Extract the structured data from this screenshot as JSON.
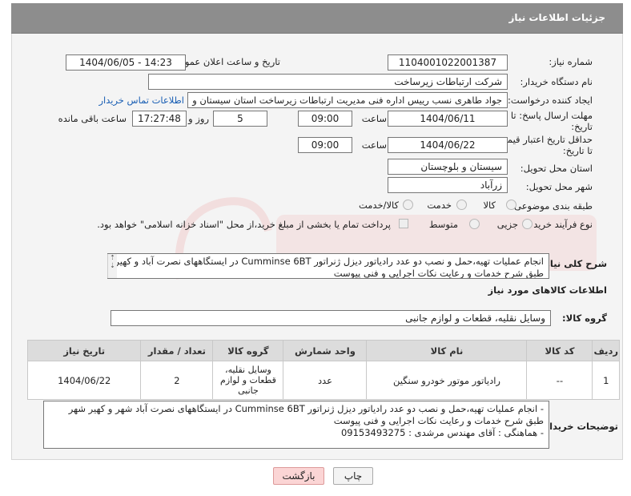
{
  "header": {
    "title": "جزئیات اطلاعات نیاز"
  },
  "fields": {
    "need_number_label": "شماره نیاز:",
    "need_number": "1104001022001387",
    "announce_label": "تاریخ و ساعت اعلان عمومی:",
    "announce_value": "1404/06/05 - 14:23",
    "buyer_org_label": "نام دستگاه خریدار:",
    "buyer_org": "شرکت ارتباطات زیرساخت",
    "creator_label": "ایجاد کننده درخواست:",
    "creator": "جواد طاهری نسب رییس اداره فنی مدیریت ارتباطات زیرساخت استان سیستان و",
    "contact_link": "اطلاعات تماس خریدار",
    "deadline_label": "مهلت ارسال پاسخ: تا",
    "deadline_label2": "تاریخ:",
    "deadline_date": "1404/06/11",
    "time_label": "ساعت",
    "deadline_time": "09:00",
    "days_value": "5",
    "days_label": "روز و",
    "remaining_time": "17:27:48",
    "remaining_label": "ساعت باقی مانده",
    "min_price_label": "حداقل تاریخ اعتبار قیمت:",
    "min_price_label2": "تا تاریخ:",
    "min_price_date": "1404/06/22",
    "min_price_time": "09:00",
    "province_label": "استان محل تحویل:",
    "province": "سیستان و بلوچستان",
    "city_label": "شهر محل تحویل:",
    "city": "زرآباد",
    "category_label": "طبقه بندی موضوعی:",
    "category_options": [
      "کالا",
      "خدمت",
      "کالا/خدمت"
    ],
    "process_label": "نوع فرآیند خرید :",
    "process_options": [
      "جزیی",
      "متوسط"
    ],
    "payment_note": "پرداخت تمام یا بخشی از مبلغ خرید،از محل \"اسناد خزانه اسلامی\" خواهد بود.",
    "description_label": "شرح کلی نیاز:",
    "description": "انجام عملیات تهیه،حمل و نصب دو عدد رادیاتور دیزل ژنراتور Cumminse 6BT در ایستگاههای نصرت آباد و کهیر طبق شرح خدمات و رعایت نکات اجرایی و فنی پیوست"
  },
  "goods": {
    "section_title": "اطلاعات کالاهای مورد نیاز",
    "group_label": "گروه کالا:",
    "group_value": "وسایل نقلیه، قطعات و لوازم جانبی",
    "columns": [
      "ردیف",
      "کد کالا",
      "نام کالا",
      "واحد شمارش",
      "گروه کالا",
      "تعداد / مقدار",
      "تاریخ نیاز"
    ],
    "rows": [
      [
        "1",
        "--",
        "رادیاتور موتور خودرو سنگین",
        "عدد",
        "وسایل نقلیه، قطعات و لوازم جانبی",
        "2",
        "1404/06/22"
      ]
    ]
  },
  "buyer_notes": {
    "label": "توضیحات خریدار:",
    "line1": "- انجام عملیات تهیه،حمل و نصب دو عدد رادیاتور دیزل ژنراتور Cumminse 6BT در ایستگاههای نصرت آباد شهر و کهیر شهر",
    "line2": "طبق شرح خدمات و رعایت نکات اجرایی و فنی پیوست",
    "line3": "- هماهنگی : آقای مهندس مرشدی : 09153493275"
  },
  "buttons": {
    "print": "چاپ",
    "back": "بازگشت"
  }
}
